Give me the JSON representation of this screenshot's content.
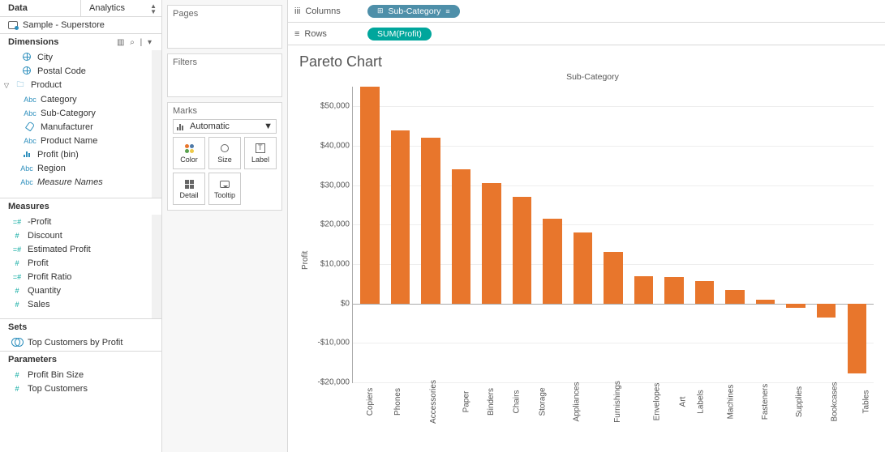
{
  "tabs": {
    "data": "Data",
    "analytics": "Analytics"
  },
  "datasource": "Sample - Superstore",
  "dimensions": {
    "title": "Dimensions",
    "items": [
      {
        "icon": "globe",
        "label": "City"
      },
      {
        "icon": "globe",
        "label": "Postal Code"
      },
      {
        "icon": "folder",
        "label": "Product",
        "caret": true
      },
      {
        "icon": "abc",
        "label": "Category",
        "indent": 1
      },
      {
        "icon": "abc",
        "label": "Sub-Category",
        "indent": 1
      },
      {
        "icon": "clip",
        "label": "Manufacturer",
        "indent": 1
      },
      {
        "icon": "abc",
        "label": "Product Name",
        "indent": 1
      },
      {
        "icon": "hist",
        "label": "Profit (bin)"
      },
      {
        "icon": "abc",
        "label": "Region"
      },
      {
        "icon": "abc",
        "label": "Measure Names",
        "italic": true
      }
    ]
  },
  "measures": {
    "title": "Measures",
    "items": [
      {
        "icon": "calc",
        "label": "-Profit"
      },
      {
        "icon": "hash",
        "label": "Discount"
      },
      {
        "icon": "calc",
        "label": "Estimated Profit"
      },
      {
        "icon": "hash",
        "label": "Profit"
      },
      {
        "icon": "calc",
        "label": "Profit Ratio"
      },
      {
        "icon": "hash",
        "label": "Quantity"
      },
      {
        "icon": "hash",
        "label": "Sales"
      }
    ]
  },
  "sets": {
    "title": "Sets",
    "items": [
      {
        "icon": "venn",
        "label": "Top Customers by Profit"
      }
    ]
  },
  "parameters": {
    "title": "Parameters",
    "items": [
      {
        "icon": "hash",
        "label": "Profit Bin Size"
      },
      {
        "icon": "hash",
        "label": "Top Customers"
      }
    ]
  },
  "pages_card": "Pages",
  "filters_card": "Filters",
  "marks_card": {
    "title": "Marks",
    "type": "Automatic",
    "btns": {
      "color": "Color",
      "size": "Size",
      "label": "Label",
      "detail": "Detail",
      "tooltip": "Tooltip"
    }
  },
  "shelves": {
    "columns_label": "Columns",
    "rows_label": "Rows",
    "columns_pill": "Sub-Category",
    "rows_pill": "SUM(Profit)"
  },
  "viz_title": "Pareto Chart",
  "chart_data": {
    "type": "bar",
    "title": "Pareto Chart",
    "x_title": "Sub-Category",
    "ylabel": "Profit",
    "ylim": [
      -20000,
      55000
    ],
    "yticks": [
      -20000,
      -10000,
      0,
      10000,
      20000,
      30000,
      40000,
      50000
    ],
    "ytick_labels": [
      "-$20,000",
      "-$10,000",
      "$0",
      "$10,000",
      "$20,000",
      "$30,000",
      "$40,000",
      "$50,000"
    ],
    "categories": [
      "Copiers",
      "Phones",
      "Accessories",
      "Paper",
      "Binders",
      "Chairs",
      "Storage",
      "Appliances",
      "Furnishings",
      "Envelopes",
      "Art",
      "Labels",
      "Machines",
      "Fasteners",
      "Supplies",
      "Bookcases",
      "Tables"
    ],
    "values": [
      55000,
      44000,
      42000,
      34000,
      30500,
      27000,
      21500,
      18000,
      13000,
      7000,
      6700,
      5600,
      3500,
      1000,
      -1200,
      -3500,
      -17700
    ]
  }
}
